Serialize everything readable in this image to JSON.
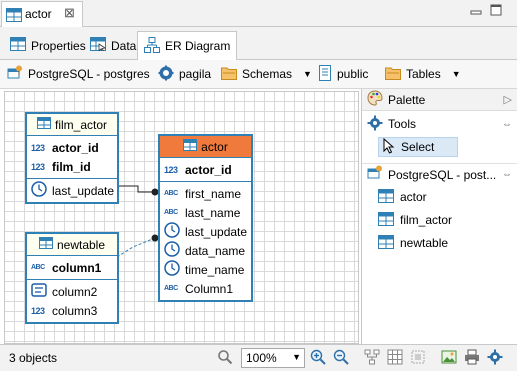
{
  "editor_tab": {
    "title": "actor",
    "close": "⊠"
  },
  "sub_tabs": {
    "properties": "Properties",
    "data": "Data",
    "er_diagram": "ER Diagram"
  },
  "toolbar": {
    "connection": "PostgreSQL - postgres",
    "database": "pagila",
    "schemas": "Schemas",
    "schema": "public",
    "tables": "Tables"
  },
  "entities": {
    "film_actor": {
      "name": "film_actor",
      "keys": [
        {
          "type": "123",
          "name": "actor_id"
        },
        {
          "type": "123",
          "name": "film_id"
        }
      ],
      "attrs": [
        {
          "type": "clock",
          "name": "last_update"
        }
      ]
    },
    "actor": {
      "name": "actor",
      "keys": [
        {
          "type": "123",
          "name": "actor_id"
        }
      ],
      "attrs": [
        {
          "type": "abc",
          "name": "first_name"
        },
        {
          "type": "abc",
          "name": "last_name"
        },
        {
          "type": "clock",
          "name": "last_update"
        },
        {
          "type": "clock",
          "name": "data_name"
        },
        {
          "type": "clock",
          "name": "time_name"
        },
        {
          "type": "abc",
          "name": "Column1"
        }
      ]
    },
    "newtable": {
      "name": "newtable",
      "keys": [
        {
          "type": "abc",
          "name": "column1"
        }
      ],
      "attrs": [
        {
          "type": "doc",
          "name": "column2"
        },
        {
          "type": "123",
          "name": "column3"
        }
      ]
    }
  },
  "palette": {
    "title": "Palette",
    "tools_title": "Tools",
    "select_label": "Select",
    "connection_title": "PostgreSQL - post...",
    "tables": [
      "actor",
      "film_actor",
      "newtable"
    ]
  },
  "status": {
    "objects": "3 objects",
    "zoom": "100%"
  },
  "colors": {
    "entity_border": "#2f80b5",
    "selected_entity_header": "#f07a3c",
    "entity_header": "#fffff0"
  }
}
